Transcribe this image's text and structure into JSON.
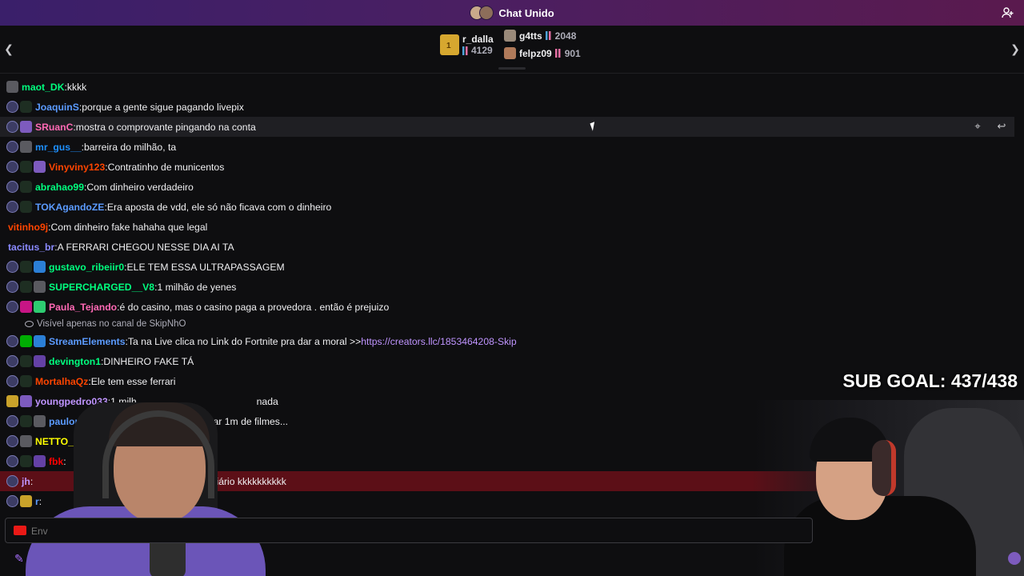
{
  "app": {
    "title": "Chat Unido"
  },
  "gifters": {
    "first": {
      "name": "r_dalla",
      "count": "4129",
      "rank": "1"
    },
    "others": [
      {
        "name": "g4tts",
        "count": "2048"
      },
      {
        "name": "felpz09",
        "count": "901"
      }
    ]
  },
  "messages": [
    {
      "user": "maot_DK",
      "color": "#00ff7f",
      "text": "kkkk",
      "badges": [
        "gray"
      ]
    },
    {
      "user": "JoaquinS",
      "color": "#5b9bff",
      "text": "porque a gente sigue pagando livepix",
      "badges": [
        "sub",
        "frog"
      ]
    },
    {
      "user": "SRuanC",
      "color": "#ff69b4",
      "text": "mostra o comprovante pingando na conta",
      "badges": [
        "sub",
        "purple"
      ],
      "hover": true
    },
    {
      "user": "mr_gus__",
      "color": "#1e90ff",
      "text": "barreira do milhão, ta",
      "badges": [
        "sub",
        "gray"
      ]
    },
    {
      "user": "Vinyviny123",
      "color": "#ff4500",
      "text": "Contratinho de municentos",
      "badges": [
        "sub",
        "frog",
        "purple"
      ]
    },
    {
      "user": "abrahao99",
      "color": "#00ff7f",
      "text": "Com dinheiro verdadeiro",
      "badges": [
        "sub",
        "frog"
      ]
    },
    {
      "user": "TOKAgandoZE",
      "color": "#5b9bff",
      "text": "Era aposta de vdd, ele só não ficava com o dinheiro",
      "badges": [
        "sub",
        "frog"
      ]
    },
    {
      "user": "vitinho9j",
      "color": "#ff4500",
      "text": "Com dinheiro fake hahaha que legal",
      "badges": []
    },
    {
      "user": "tacitus_br",
      "color": "#8a8aff",
      "text": "A FERRARI CHEGOU NESSE DIA AI TA",
      "badges": []
    },
    {
      "user": "gustavo_ribeiir0",
      "color": "#00ff7f",
      "text": "ELE TEM ESSA ULTRAPASSAGEM",
      "badges": [
        "sub",
        "frog",
        "crown"
      ]
    },
    {
      "user": "SUPERCHARGED__V8",
      "color": "#00ff7f",
      "text": "1 milhão de yenes",
      "badges": [
        "sub",
        "frog",
        "gray"
      ]
    },
    {
      "user": "Paula_Tejando",
      "color": "#ff69b4",
      "text": "é do casino, mas o casino paga a provedora . então é prejuizo",
      "badges": [
        "sub",
        "heart",
        "green"
      ]
    }
  ],
  "system_note": "Visível apenas no canal de SkipNhO",
  "messages2": [
    {
      "user": "StreamElements",
      "color": "#5b9bff",
      "text": "Ta na Live clica no Link do Fortnite pra dar a moral >> ",
      "link": "https://creators.llc/1853464208-Skip",
      "badges": [
        "sub",
        "mod",
        "crown"
      ]
    },
    {
      "user": "devington1",
      "color": "#00ff7f",
      "text": "DINHEIRO FAKE TÁ",
      "badges": [
        "sub",
        "frog",
        "cam"
      ]
    },
    {
      "user": "MortalhaQz",
      "color": "#ff4500",
      "text": "Ele tem esse ferrari",
      "badges": [
        "sub",
        "frog"
      ]
    },
    {
      "user": "youngpedro033",
      "color": "#bf94ff",
      "text": "1 milh",
      "text_tail": "nada",
      "badges": [
        "yellow",
        "purple"
      ]
    },
    {
      "user": "paulon",
      "color": "#5b9bff",
      "text": "",
      "text_tail": "ssar 1m de filmes...",
      "badges": [
        "sub",
        "frog",
        "gray"
      ]
    },
    {
      "user": "NETTO_",
      "color": "#ffff00",
      "text": "",
      "badges": [
        "sub",
        "gray"
      ]
    },
    {
      "user": "fbk",
      "color": "#ff0000",
      "text": "",
      "badges": [
        "sub",
        "frog",
        "cam"
      ]
    },
    {
      "user": "jh",
      "color": "#bf94ff",
      "text": "",
      "text_tail": "e banco Imobiliário kkkkkkkkkk",
      "badges": [
        "sub"
      ],
      "highlight": true
    },
    {
      "user": "r",
      "color": "#5b9bff",
      "text": "",
      "badges": [
        "sub",
        "yellow"
      ]
    }
  ],
  "overlay": {
    "sub_goal": "SUB GOAL: 437/438"
  },
  "input": {
    "placeholder": "Env"
  },
  "colors": {
    "accent": "#a970ff",
    "topbar": "#4a1f62",
    "highlight_row": "#5c0f17"
  }
}
